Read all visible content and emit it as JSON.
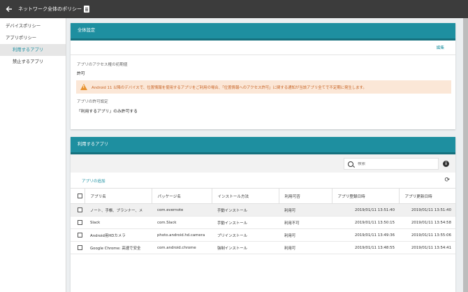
{
  "header": {
    "title": "ネットワーク全体のポリシー"
  },
  "sidebar": {
    "items": [
      {
        "label": "デバイスポリシー"
      },
      {
        "label": "アプリポリシー"
      },
      {
        "label": "利用するアプリ"
      },
      {
        "label": "禁止するアプリ"
      }
    ]
  },
  "general": {
    "title": "全体設定",
    "edit_label": "編集",
    "access_label": "アプリのアクセス権の初期値",
    "access_value": "許可",
    "warning": "Android 11 以降のデバイスで、位置情報を使用するアプリをご利用の場合、「位置情報へのアクセス許可」に関する通知が当該アプリ全てで不定期に発生します。",
    "permission_label": "アプリの許可設定",
    "permission_value": "「利用するアプリ」のみ許可する"
  },
  "apps": {
    "title": "利用するアプリ",
    "search_placeholder": "検索",
    "add_label": "アプリの追加",
    "columns": [
      "アプリ名",
      "パッケージ名",
      "インストール方法",
      "利用可否",
      "アプリ登録日時",
      "アプリ更新日時"
    ],
    "rows": [
      [
        "ノート、手帳、プランナー、メ",
        "com.evernote",
        "手動インストール",
        "利用可",
        "2019/01/11 13:51:40",
        "2019/01/11 13:51:40"
      ],
      [
        "Slack",
        "com.Slack",
        "手動インストール",
        "利用不可",
        "2019/01/11 13:50:15",
        "2019/01/11 13:54:58"
      ],
      [
        "Android用HDカメラ",
        "photo.android.hd.camera",
        "プリインストール",
        "利用可",
        "2019/01/11 13:49:36",
        "2019/01/11 13:55:06"
      ],
      [
        "Google Chrome: 高速で安全",
        "com.android.chrome",
        "強制インストール",
        "利用可",
        "2019/01/11 13:48:55",
        "2019/01/11 13:54:41"
      ]
    ]
  },
  "colors": {
    "accent": "#1e8fa0",
    "topbar": "#3c3c3c",
    "warning_bg": "#fbe7d7",
    "warning_text": "#c76324"
  }
}
